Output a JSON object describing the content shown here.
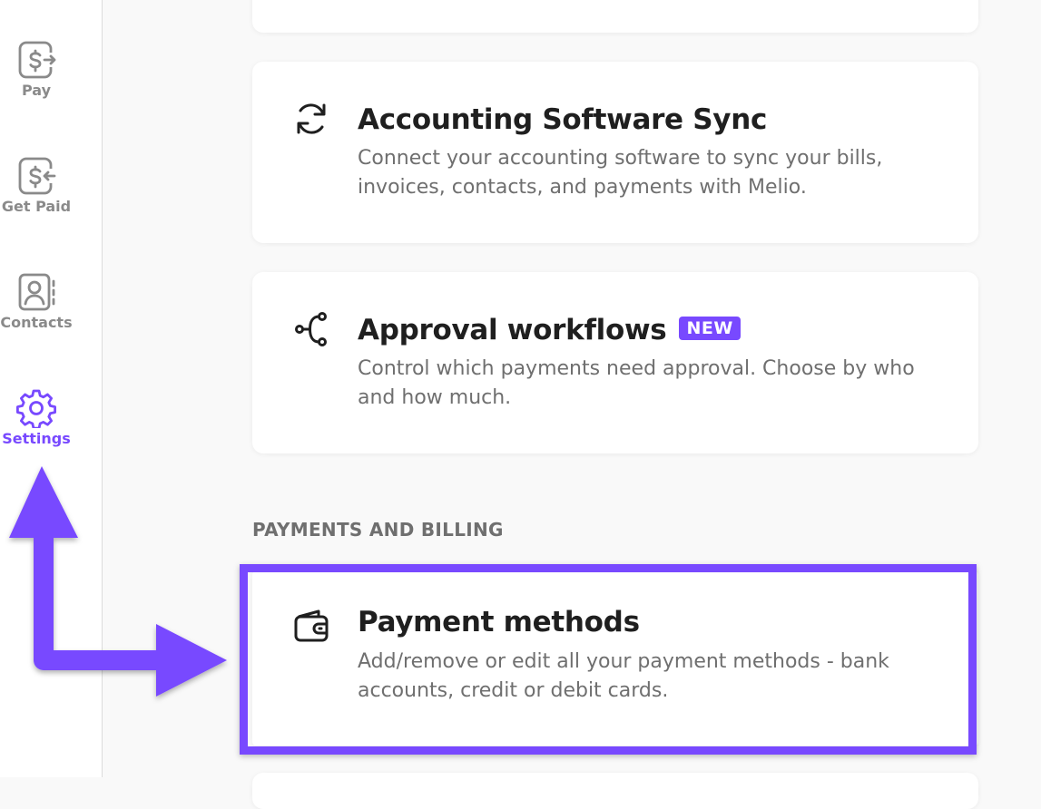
{
  "sidebar": {
    "items": [
      {
        "label": "Pay",
        "icon": "dollar-out-icon"
      },
      {
        "label": "Get Paid",
        "icon": "dollar-in-icon"
      },
      {
        "label": "Contacts",
        "icon": "contacts-book-icon"
      },
      {
        "label": "Settings",
        "icon": "gear-icon",
        "active": true
      }
    ]
  },
  "cards": {
    "accounting": {
      "icon": "sync-icon",
      "title": "Accounting Software Sync",
      "description": "Connect your accounting software to sync your bills, invoices, contacts, and payments with Melio."
    },
    "approval": {
      "icon": "workflow-icon",
      "title": "Approval workflows",
      "badge": "NEW",
      "description": "Control which payments need approval. Choose by who and how much."
    },
    "payment_methods": {
      "icon": "wallet-icon",
      "title": "Payment methods",
      "description": "Add/remove or edit all your payment methods - bank accounts, credit or debit cards."
    }
  },
  "sections": {
    "payments_billing": "PAYMENTS AND BILLING"
  },
  "colors": {
    "accent": "#7849ff",
    "muted_text": "#8a8a8a",
    "body_text": "#6f6f6f",
    "title_text": "#1f1f1f",
    "background": "#f9f9f9"
  }
}
